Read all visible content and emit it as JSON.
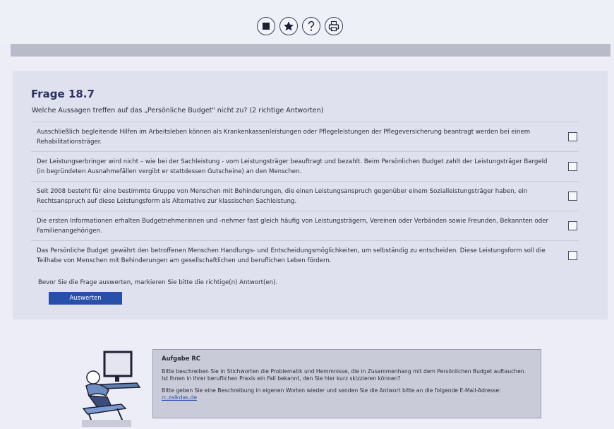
{
  "toolbar": {
    "buttons": [
      {
        "name": "stop-button",
        "icon": "stop-square-icon"
      },
      {
        "name": "favorite-button",
        "icon": "star-icon"
      },
      {
        "name": "help-button",
        "icon": "question-icon"
      },
      {
        "name": "print-button",
        "icon": "printer-icon"
      }
    ]
  },
  "question": {
    "title": "Frage 18.7",
    "text": "Welche Aussagen treffen auf das „Persönliche Budget\" nicht zu? (2 richtige Antworten)",
    "options": [
      {
        "text": "Ausschließlich begleitende Hilfen im Arbeitsleben können als Krankenkassenleistungen oder Pflegeleistungen der Pflegeversicherung beantragt werden bei einem Rehabilitationsträger.",
        "checked": false
      },
      {
        "text": "Der Leistungserbringer wird nicht – wie bei der Sachleistung - vom Leistungsträger beauftragt und bezahlt. Beim Persönlichen Budget zahlt der Leistungsträger Bargeld (in begründeten Ausnahmefällen vergibt er stattdessen Gutscheine) an den Menschen.",
        "checked": false
      },
      {
        "text": "Seit 2008 besteht für eine bestimmte Gruppe von Menschen mit Behinderungen, die einen Leistungsanspruch gegenüber einem Sozialleistungsträger haben, ein Rechtsanspruch auf diese Leistungsform als Alternative zur klassischen Sachleistung.",
        "checked": false
      },
      {
        "text": "Die ersten Informationen erhalten Budgetnehmerinnen und -nehmer fast gleich häufig von Leistungsträgern, Vereinen oder Verbänden sowie Freunden, Bekannten oder Familienangehörigen.",
        "checked": false
      },
      {
        "text": "Das Persönliche Budget gewährt den betroffenen Menschen Handlungs- und Entscheidungsmöglichkeiten, um selbständig zu entscheiden. Diese Leistungsform soll die Teilhabe von Menschen mit Behinderungen am gesellschaftlichen und beruflichen Leben fördern.",
        "checked": false
      }
    ],
    "hint": "Bevor Sie die Frage auswerten, markieren Sie bitte die richtige(n) Antwort(en).",
    "evaluate_label": "Auswerten"
  },
  "task": {
    "title": "Aufgabe RC",
    "line1": "Bitte beschreiben Sie in Stichworten die Problematik und Hemmnisse, die in Zusammenhang mit dem Persönlichen Budget auftauchen.",
    "line2": "Ist Ihnen in Ihrer beruflichen Praxis ein Fall bekannt, den Sie hier kurz skizzieren können?",
    "line3": "Bitte geben Sie eine Beschreibung in eigenen Worten wieder und  senden Sie die Antwort bitte an die folgende E-Mail-Adresse:",
    "email": "rc.zalkdas.de"
  },
  "colors": {
    "accent": "#2950a8",
    "title": "#2d3160",
    "panel": "#dfe1ef",
    "task_box": "#c9cbd9"
  }
}
